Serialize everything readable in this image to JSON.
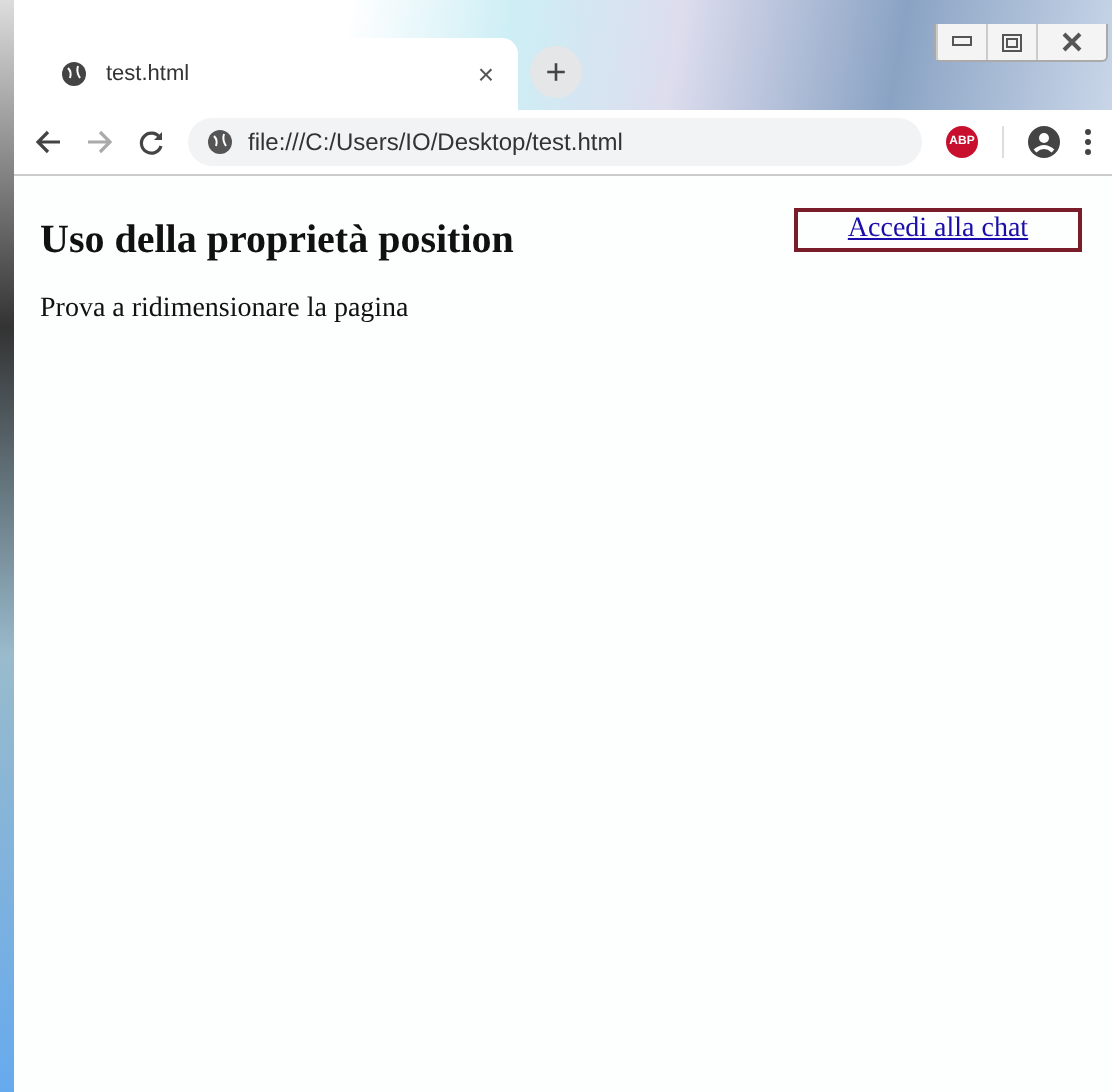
{
  "tabs": [
    {
      "title": "test.html",
      "selected": true,
      "close": "×"
    }
  ],
  "new_tab": "+",
  "address_bar": {
    "url": "file:///C:/Users/IO/Desktop/test.html"
  },
  "extension_badge": "ABP",
  "page": {
    "heading": "Uso della proprietà position",
    "link": "Accedi alla chat",
    "paragraph": "Prova a ridimensionare la pagina"
  }
}
